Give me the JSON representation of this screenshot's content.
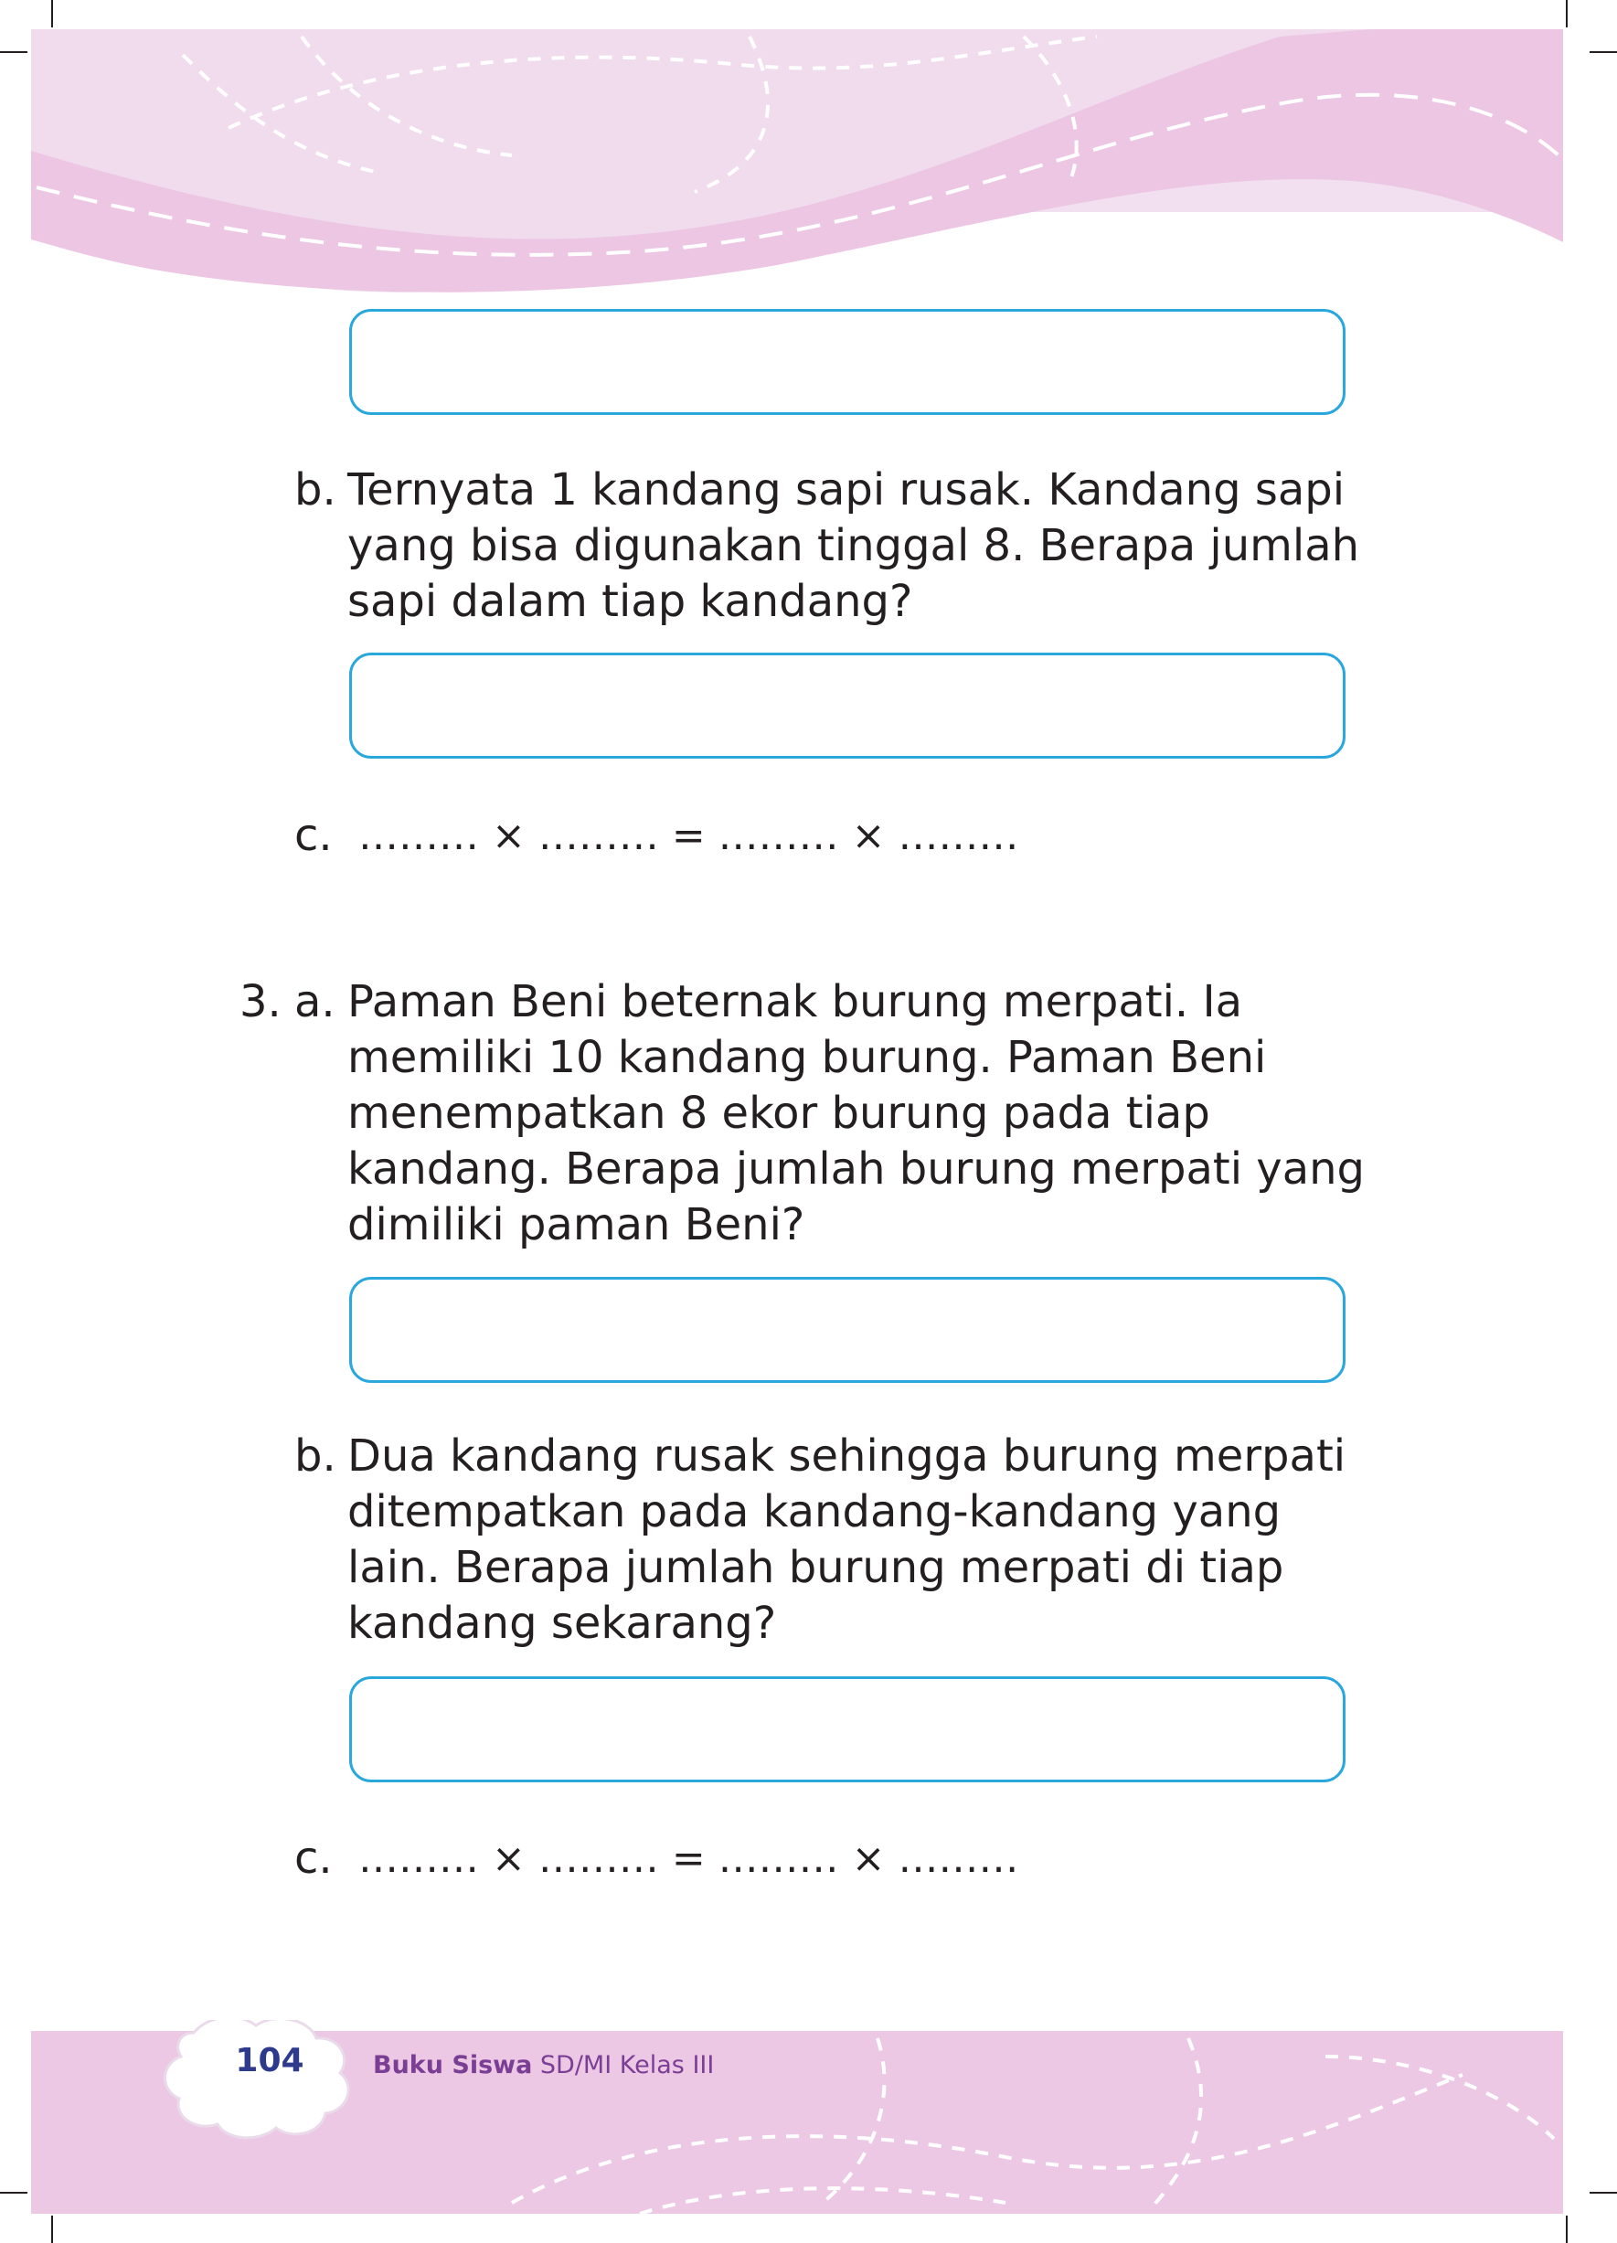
{
  "header": {
    "band_color": "#efd9ec",
    "accent_color": "#e8c3e0"
  },
  "problem_2": {
    "b": {
      "marker": "b.",
      "lines": [
        "Ternyata 1 kandang sapi rusak. Kandang sapi",
        "yang bisa digunakan tinggal 8. Berapa jumlah",
        "sapi dalam tiap kandang?"
      ]
    },
    "c": {
      "marker": "c.",
      "equation": "……… × ……… = ……… × ………"
    }
  },
  "problem_3": {
    "number": "3.",
    "a": {
      "marker": "a.",
      "lines": [
        "Paman Beni beternak burung merpati. Ia",
        "memiliki 10 kandang burung. Paman Beni",
        "menempatkan 8 ekor burung pada tiap",
        "kandang. Berapa jumlah burung merpati yang",
        "dimiliki paman Beni?"
      ]
    },
    "b": {
      "marker": "b.",
      "lines": [
        "Dua kandang rusak sehingga burung merpati",
        "ditempatkan pada kandang-kandang yang",
        "lain. Berapa jumlah burung merpati di tiap",
        "kandang sekarang?"
      ]
    },
    "c": {
      "marker": "c.",
      "equation": "……… × ……… = ……… × ………"
    }
  },
  "footer": {
    "page_number": "104",
    "book_title_bold": "Buku Siswa",
    "book_title_rest": " SD/MI Kelas III"
  },
  "colors": {
    "answer_box_border": "#2aa7dc",
    "band_pink": "#ecc8e4",
    "page_number": "#2e3a8c",
    "footer_text": "#7a3e94"
  }
}
